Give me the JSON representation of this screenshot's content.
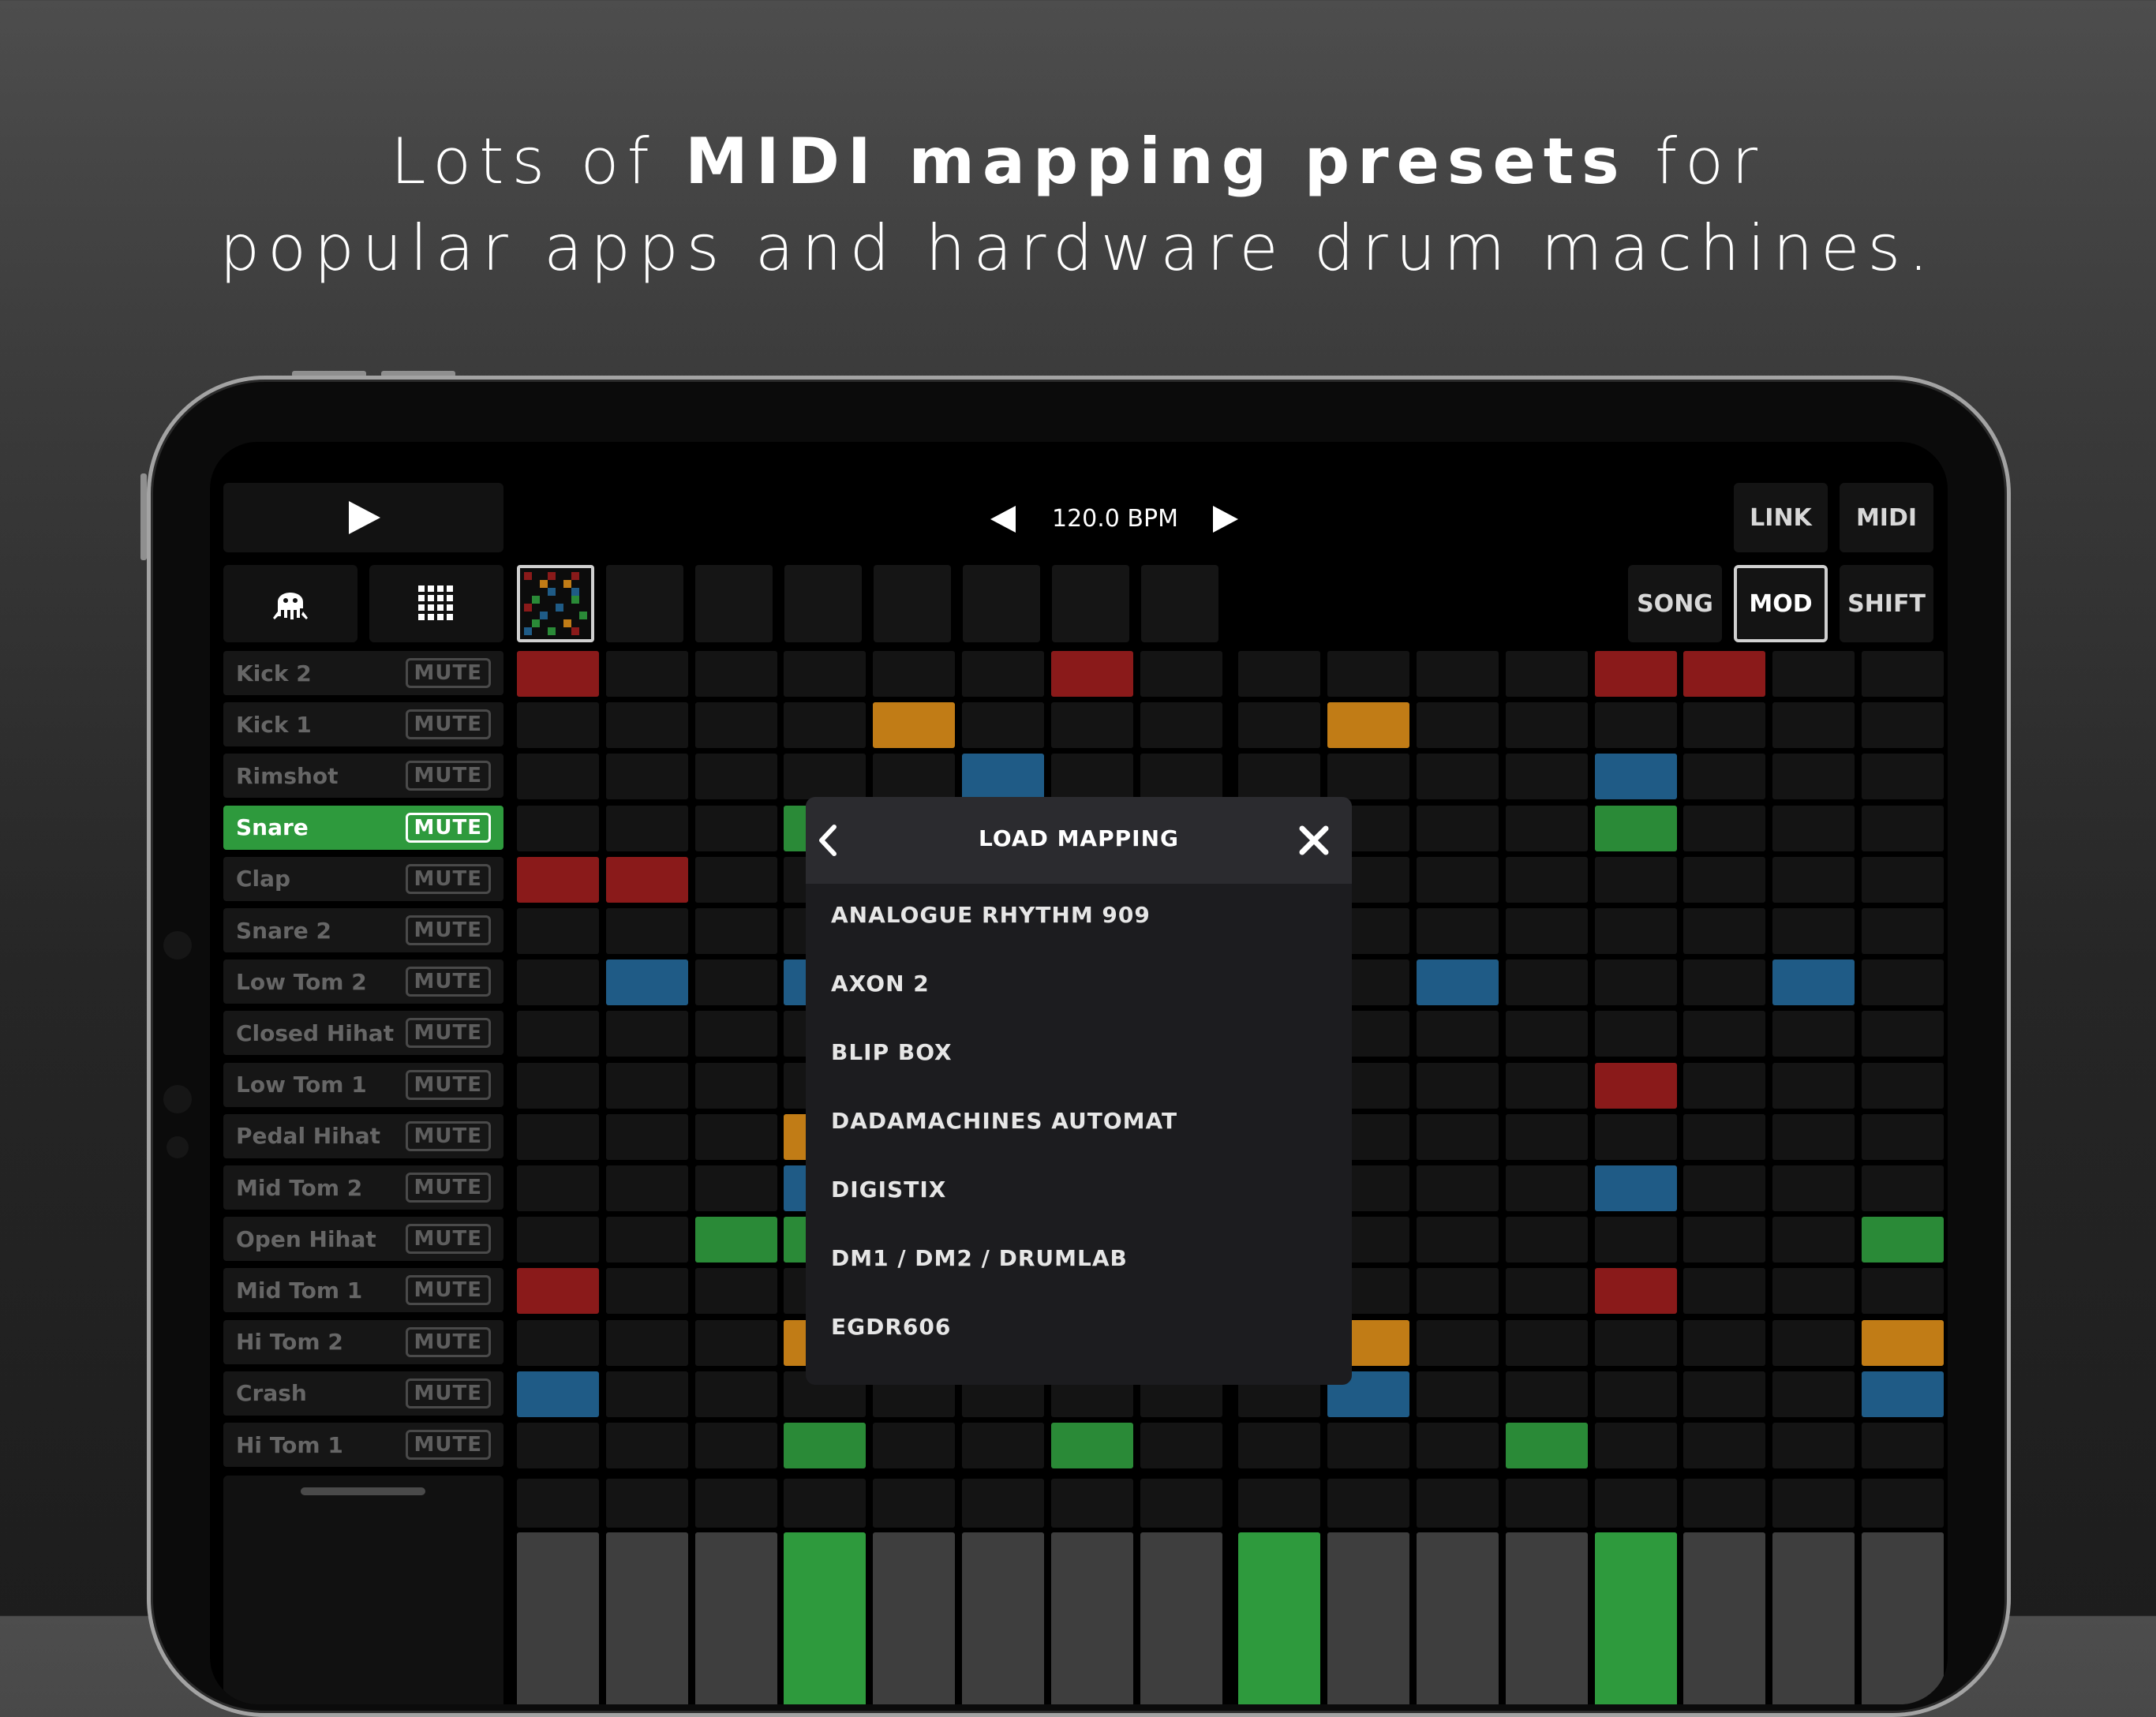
{
  "headline": {
    "line1_pre": "Lots of ",
    "line1_bold": "MIDI mapping presets",
    "line1_post": " for",
    "line2": "popular apps and hardware drum machines."
  },
  "colors": {
    "red": "#8a1a1a",
    "orange": "#c17c16",
    "blue": "#1f5b86",
    "green": "#2a8a37",
    "bright_green": "#2e9a3d",
    "empty": "#141414",
    "grey": "#3e3e3e"
  },
  "icons": {
    "play": "play-icon",
    "octopus": "octopus-icon",
    "grid": "grid-icon",
    "prev": "triangle-left-icon",
    "next": "triangle-right-icon",
    "back": "chevron-left-icon",
    "close": "close-icon"
  },
  "transport": {
    "bpm": "120.0 BPM"
  },
  "buttons": {
    "link": "LINK",
    "midi": "MIDI",
    "song": "SONG",
    "mod": "MOD",
    "shift": "SHIFT"
  },
  "tracks": [
    {
      "name": "Kick 2",
      "mute": "MUTE",
      "selected": false
    },
    {
      "name": "Kick 1",
      "mute": "MUTE",
      "selected": false
    },
    {
      "name": "Rimshot",
      "mute": "MUTE",
      "selected": false
    },
    {
      "name": "Snare",
      "mute": "MUTE",
      "selected": true
    },
    {
      "name": "Clap",
      "mute": "MUTE",
      "selected": false
    },
    {
      "name": "Snare 2",
      "mute": "MUTE",
      "selected": false
    },
    {
      "name": "Low Tom 2",
      "mute": "MUTE",
      "selected": false
    },
    {
      "name": "Closed Hihat",
      "mute": "MUTE",
      "selected": false
    },
    {
      "name": "Low Tom 1",
      "mute": "MUTE",
      "selected": false
    },
    {
      "name": "Pedal Hihat",
      "mute": "MUTE",
      "selected": false
    },
    {
      "name": "Mid Tom 2",
      "mute": "MUTE",
      "selected": false
    },
    {
      "name": "Open Hihat",
      "mute": "MUTE",
      "selected": false
    },
    {
      "name": "Mid Tom 1",
      "mute": "MUTE",
      "selected": false
    },
    {
      "name": "Hi Tom 2",
      "mute": "MUTE",
      "selected": false
    },
    {
      "name": "Crash",
      "mute": "MUTE",
      "selected": false
    },
    {
      "name": "Hi Tom 1",
      "mute": "MUTE",
      "selected": false
    }
  ],
  "steps": [
    {
      "row": 0,
      "col": 0,
      "color": "red"
    },
    {
      "row": 0,
      "col": 6,
      "color": "red"
    },
    {
      "row": 0,
      "col": 12,
      "color": "red"
    },
    {
      "row": 0,
      "col": 13,
      "color": "red"
    },
    {
      "row": 1,
      "col": 4,
      "color": "orange"
    },
    {
      "row": 1,
      "col": 9,
      "color": "orange"
    },
    {
      "row": 2,
      "col": 5,
      "color": "blue"
    },
    {
      "row": 2,
      "col": 12,
      "color": "blue"
    },
    {
      "row": 3,
      "col": 3,
      "color": "green"
    },
    {
      "row": 3,
      "col": 12,
      "color": "green"
    },
    {
      "row": 4,
      "col": 0,
      "color": "red"
    },
    {
      "row": 4,
      "col": 1,
      "color": "red"
    },
    {
      "row": 6,
      "col": 1,
      "color": "blue"
    },
    {
      "row": 6,
      "col": 3,
      "color": "blue"
    },
    {
      "row": 6,
      "col": 10,
      "color": "blue"
    },
    {
      "row": 6,
      "col": 14,
      "color": "blue"
    },
    {
      "row": 8,
      "col": 12,
      "color": "red"
    },
    {
      "row": 9,
      "col": 3,
      "color": "orange"
    },
    {
      "row": 10,
      "col": 3,
      "color": "blue"
    },
    {
      "row": 10,
      "col": 12,
      "color": "blue"
    },
    {
      "row": 11,
      "col": 2,
      "color": "green"
    },
    {
      "row": 11,
      "col": 3,
      "color": "green"
    },
    {
      "row": 11,
      "col": 15,
      "color": "green"
    },
    {
      "row": 12,
      "col": 0,
      "color": "red"
    },
    {
      "row": 12,
      "col": 12,
      "color": "red"
    },
    {
      "row": 13,
      "col": 3,
      "color": "orange"
    },
    {
      "row": 13,
      "col": 9,
      "color": "orange"
    },
    {
      "row": 13,
      "col": 15,
      "color": "orange"
    },
    {
      "row": 14,
      "col": 0,
      "color": "blue"
    },
    {
      "row": 14,
      "col": 9,
      "color": "blue"
    },
    {
      "row": 14,
      "col": 15,
      "color": "blue"
    },
    {
      "row": 15,
      "col": 3,
      "color": "green"
    },
    {
      "row": 15,
      "col": 6,
      "color": "green"
    },
    {
      "row": 15,
      "col": 11,
      "color": "green"
    }
  ],
  "playhead_steps": [
    3,
    8,
    12
  ],
  "modal": {
    "title": "LOAD MAPPING",
    "items": [
      "ANALOGUE RHYTHM 909",
      "AXON 2",
      "BLIP BOX",
      "DADAMACHINES AUTOMAT",
      "DIGISTIX",
      "DM1 / DM2 / DRUMLAB",
      "EGDR606"
    ]
  }
}
